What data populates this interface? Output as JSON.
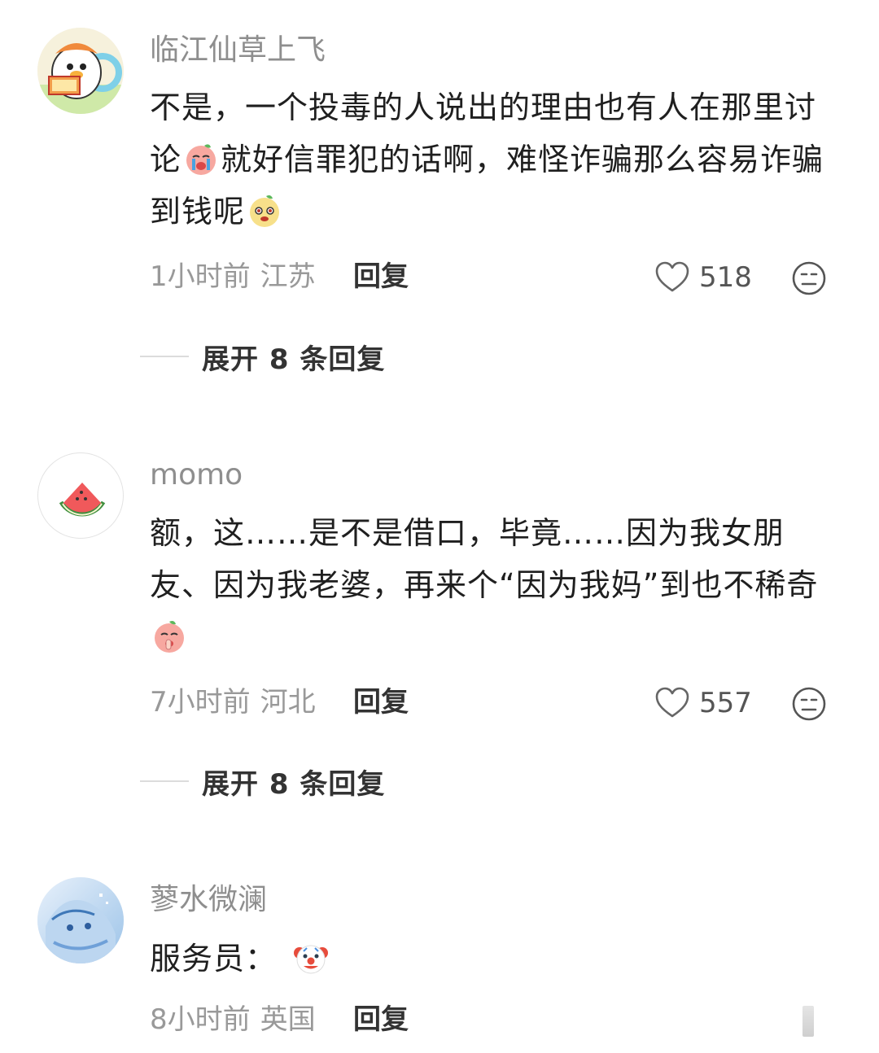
{
  "comments": [
    {
      "username": "临江仙草上飞",
      "avatar_icon": "cartoon-duck-icon",
      "text_parts": [
        "不是，一个投毒的人说出的理由也有人在那里讨论",
        "就好信罪犯的话啊，难怪诈骗那么容易诈骗到钱呢"
      ],
      "emojis": [
        "crying-peach-emoji",
        "smirk-peach-emoji"
      ],
      "time": "1小时前",
      "location": "江苏",
      "reply_label": "回复",
      "likes": "518",
      "expand_label": "展开 8 条回复"
    },
    {
      "username": "momo",
      "avatar_icon": "watermelon-icon",
      "text_parts": [
        "额，这……是不是借口，毕竟……因为我女朋友、因为我老婆，再来个“因为我妈”到也不稀奇"
      ],
      "emojis": [
        "shush-peach-emoji"
      ],
      "time": "7小时前",
      "location": "河北",
      "reply_label": "回复",
      "likes": "557",
      "expand_label": "展开 8 条回复"
    },
    {
      "username": "蓼水微澜",
      "avatar_icon": "anime-character-icon",
      "text_parts": [
        "服务员："
      ],
      "emojis": [
        "clown-emoji"
      ],
      "time": "8小时前",
      "location": "英国",
      "reply_label": "回复"
    }
  ],
  "colors": {
    "username": "#8e8e8e",
    "meta": "#999999",
    "text": "#1f1f1f"
  }
}
